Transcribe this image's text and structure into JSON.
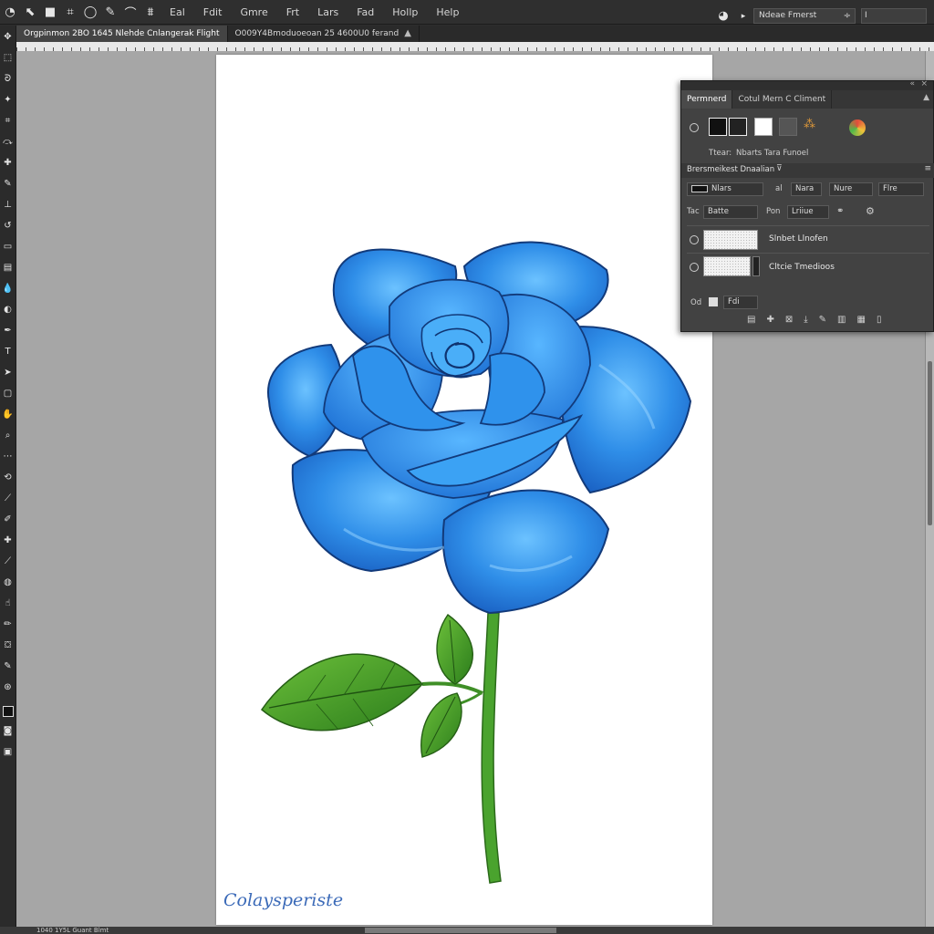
{
  "menubar": {
    "tool_icons": [
      "ellipse-icon",
      "move-icon",
      "lock-icon",
      "crop-icon",
      "circle-icon",
      "brush-icon",
      "lasso-icon",
      "gradient-icon"
    ],
    "items": [
      "Eal",
      "Fdit",
      "Gmre",
      "Frt",
      "Lars",
      "Fad",
      "Hollp",
      "Help"
    ],
    "workspace_select": "Ndeae Fmerst",
    "search_value": "Ⅰ"
  },
  "tabs": [
    {
      "label": "Orgpinmon 2BO 1645 Nlehde Cnlangerak Flight",
      "active": true
    },
    {
      "label": "O009Y4Bmoduoeoan 25 4600U0 ferand",
      "active": false
    }
  ],
  "canvas": {
    "signature": "Colaysperiste"
  },
  "panel": {
    "tabs": [
      "Permnerd",
      "Cotul Mern C Climent"
    ],
    "swatch_label": "Ttear:",
    "swatch_value": "Nbarts Tara Funoel",
    "section_title": "Brersmeikest Dnaalian",
    "blend_mode": "Nlars",
    "opacity_label": "al",
    "opacity_value": "Nara",
    "fill_mode": "Nure",
    "fill_value": "Flre",
    "lock_label": "Tac",
    "lock_value": "Batte",
    "position_label": "Pon",
    "position_value": "Lriiue",
    "layers": [
      {
        "name": "Slnbet Llnofen"
      },
      {
        "name": "Cltcie Tmedioos"
      }
    ],
    "footer_left": "Od",
    "footer_field": "Fdi"
  },
  "status": {
    "text": "1040 1Y5L    Guant Blmt"
  },
  "colors": {
    "rose_main": "#2f8ee8",
    "rose_outline": "#123a7a",
    "leaf": "#3f9a2a",
    "stem": "#4aa32e",
    "signature": "#3b6ab8"
  }
}
